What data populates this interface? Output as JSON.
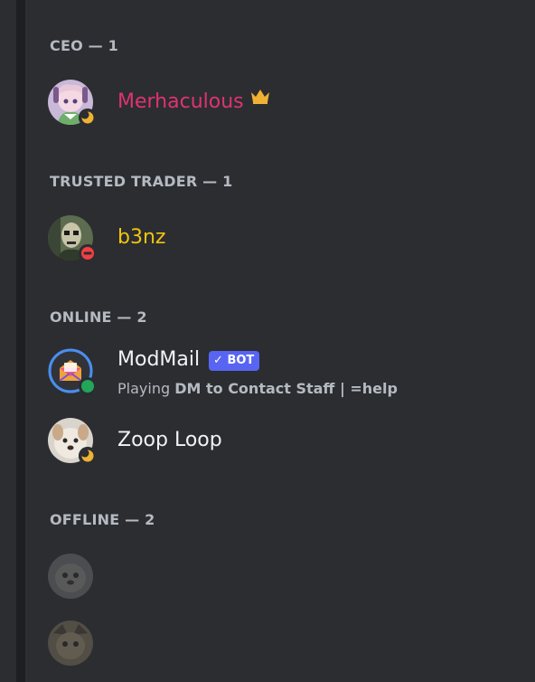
{
  "sections": [
    {
      "header": "CEO — 1",
      "members": [
        {
          "name": "Merhaculous",
          "name_color": "#e0336e",
          "status": "idle",
          "badge": "crown-icon"
        }
      ]
    },
    {
      "header": "TRUSTED TRADER — 1",
      "members": [
        {
          "name": "b3nz",
          "name_color": "#f1c40f",
          "status": "dnd"
        }
      ]
    },
    {
      "header": "ONLINE — 2",
      "members": [
        {
          "name": "ModMail",
          "name_color": "#f2f3f5",
          "status": "online",
          "tag": "BOT",
          "activity_prefix": "Playing ",
          "activity": "DM to Contact Staff | =help"
        },
        {
          "name": "Zoop Loop",
          "name_color": "#f2f3f5",
          "status": "idle"
        }
      ]
    },
    {
      "header": "OFFLINE — 2",
      "members": [
        {
          "name": "",
          "status": "offline"
        },
        {
          "name": "",
          "status": "offline"
        }
      ]
    }
  ],
  "colors": {
    "background": "#2b2d31",
    "header_text": "#b5bac1",
    "idle": "#f0b232",
    "dnd": "#f23f43",
    "online": "#23a55a",
    "bot_tag": "#5865f2",
    "crown": "#f0b232"
  }
}
